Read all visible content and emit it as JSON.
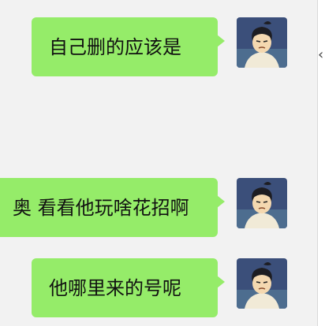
{
  "messages": [
    {
      "text": "自己删的应该是"
    },
    {
      "text": "奥 看看他玩啥花招啊"
    },
    {
      "text": "他哪里来的号呢"
    }
  ],
  "colors": {
    "bubble": "#95ec69",
    "background": "#f2f2f2",
    "text": "#111111"
  },
  "avatar": {
    "icon": "cartoon-boy-avatar-icon"
  }
}
